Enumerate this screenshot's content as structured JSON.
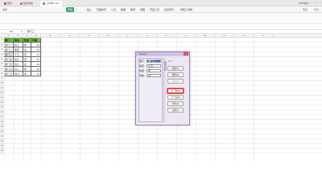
{
  "titlebar": {
    "tabs": [
      {
        "label": "首页",
        "active": false,
        "color": "#d04a3a"
      },
      {
        "label": "稻壳模板",
        "active": false,
        "color": "#e0663f"
      },
      {
        "label": "工作簿1.xlsx",
        "active": true,
        "color": "#3fa36b"
      }
    ],
    "user": "WPS用户",
    "controls": [
      "–",
      "□",
      "×"
    ]
  },
  "menubar": {
    "items": [
      "文件",
      "开始",
      "插入",
      "页面布局",
      "公式",
      "数据",
      "审阅",
      "视图",
      "开发工具",
      "会员专享",
      "智能工具箱"
    ],
    "active_item": "插入",
    "accent": "#3fa36b",
    "search_label": "查找",
    "share_label": "分享"
  },
  "formula": {
    "cell_ref": "A3",
    "fx": "fx",
    "value": "部门三"
  },
  "sheet": {
    "columns": [
      "A",
      "B",
      "C",
      "D",
      "E",
      "F",
      "G",
      "H",
      "I",
      "J",
      "K",
      "L",
      "M",
      "N",
      "O",
      "P"
    ],
    "rows": [
      "1",
      "2",
      "3",
      "4",
      "5",
      "6",
      "7",
      "8",
      "9",
      "10",
      "11",
      "12",
      "13",
      "14",
      "15",
      "16",
      "17",
      "18",
      "19",
      "20",
      "21",
      "22",
      "23",
      "24"
    ],
    "header": [
      "部门",
      "姓名",
      "性别",
      "年龄"
    ],
    "records": [
      [
        "部门一",
        "张三",
        "男",
        "22"
      ],
      [
        "部门二",
        "李四",
        "女",
        "23"
      ],
      [
        "部门三",
        "王五",
        "男",
        "22"
      ],
      [
        "部门四",
        "赵六",
        "男",
        "25"
      ],
      [
        "部门五",
        "钱七",
        "女",
        "26"
      ],
      [
        "部门六",
        "孙八",
        "男",
        "22"
      ],
      [
        "部门七",
        "周九",
        "男",
        "21"
      ]
    ]
  },
  "dialog": {
    "title": "Sheet1",
    "close": "×",
    "fields": [
      {
        "label": "部门:",
        "value": "部门三"
      },
      {
        "label": "姓名:",
        "value": "王五"
      },
      {
        "label": "性别:",
        "value": "男"
      },
      {
        "label": "年龄:",
        "value": "22"
      }
    ],
    "status": "3 / 7",
    "buttons": [
      {
        "label": "新建(W)",
        "disabled": false
      },
      {
        "label": "删除(D)",
        "disabled": false
      },
      {
        "label": "还原(R)",
        "disabled": true
      },
      {
        "label": "上一条(P)",
        "disabled": false
      },
      {
        "label": "下一条(N)",
        "disabled": false
      },
      {
        "label": "条件(C)",
        "disabled": false
      },
      {
        "label": "关闭(L)",
        "disabled": false
      }
    ]
  }
}
